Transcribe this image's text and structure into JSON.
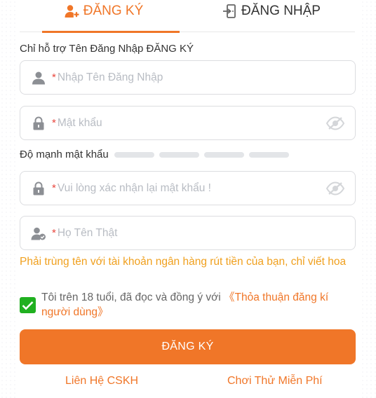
{
  "tabs": {
    "register_label": "ĐĂNG KÝ",
    "login_label": "ĐĂNG NHẬP"
  },
  "form": {
    "hint": "Chỉ hỗ trợ Tên Đăng Nhập ĐĂNG KÝ",
    "required_mark": "*",
    "username_placeholder": "Nhập Tên Đăng Nhập",
    "password_placeholder": "Mật khẩu",
    "strength_label": "Độ mạnh mật khẩu",
    "strength_level": 0,
    "confirm_placeholder": "Vui lòng xác nhận lại mật khẩu !",
    "realname_placeholder": "Họ Tên Thật",
    "realname_warning": "Phải trùng tên với tài khoản ngân hàng rút tiền của bạn, chỉ viết hoa",
    "agree_checked": true,
    "agree_text": "Tôi trên 18 tuổi, đã đọc và đồng ý với ",
    "agree_link": "《Thỏa thuận đăng kí người dùng》",
    "submit_label": "ĐĂNG KÝ"
  },
  "footer": {
    "support_label": "Liên Hệ CSKH",
    "trial_label": "Chơi Thử Miễn Phí"
  },
  "colors": {
    "accent": "#f07628",
    "warning": "#f0a01e",
    "required": "#e8453c",
    "checkbox": "#20b020"
  },
  "icons": {
    "register_tab": "user-add-icon",
    "login_tab": "login-door-icon",
    "username": "user-icon",
    "password": "lock-icon",
    "realname": "user-verified-icon",
    "visibility": "eye-off-icon"
  }
}
